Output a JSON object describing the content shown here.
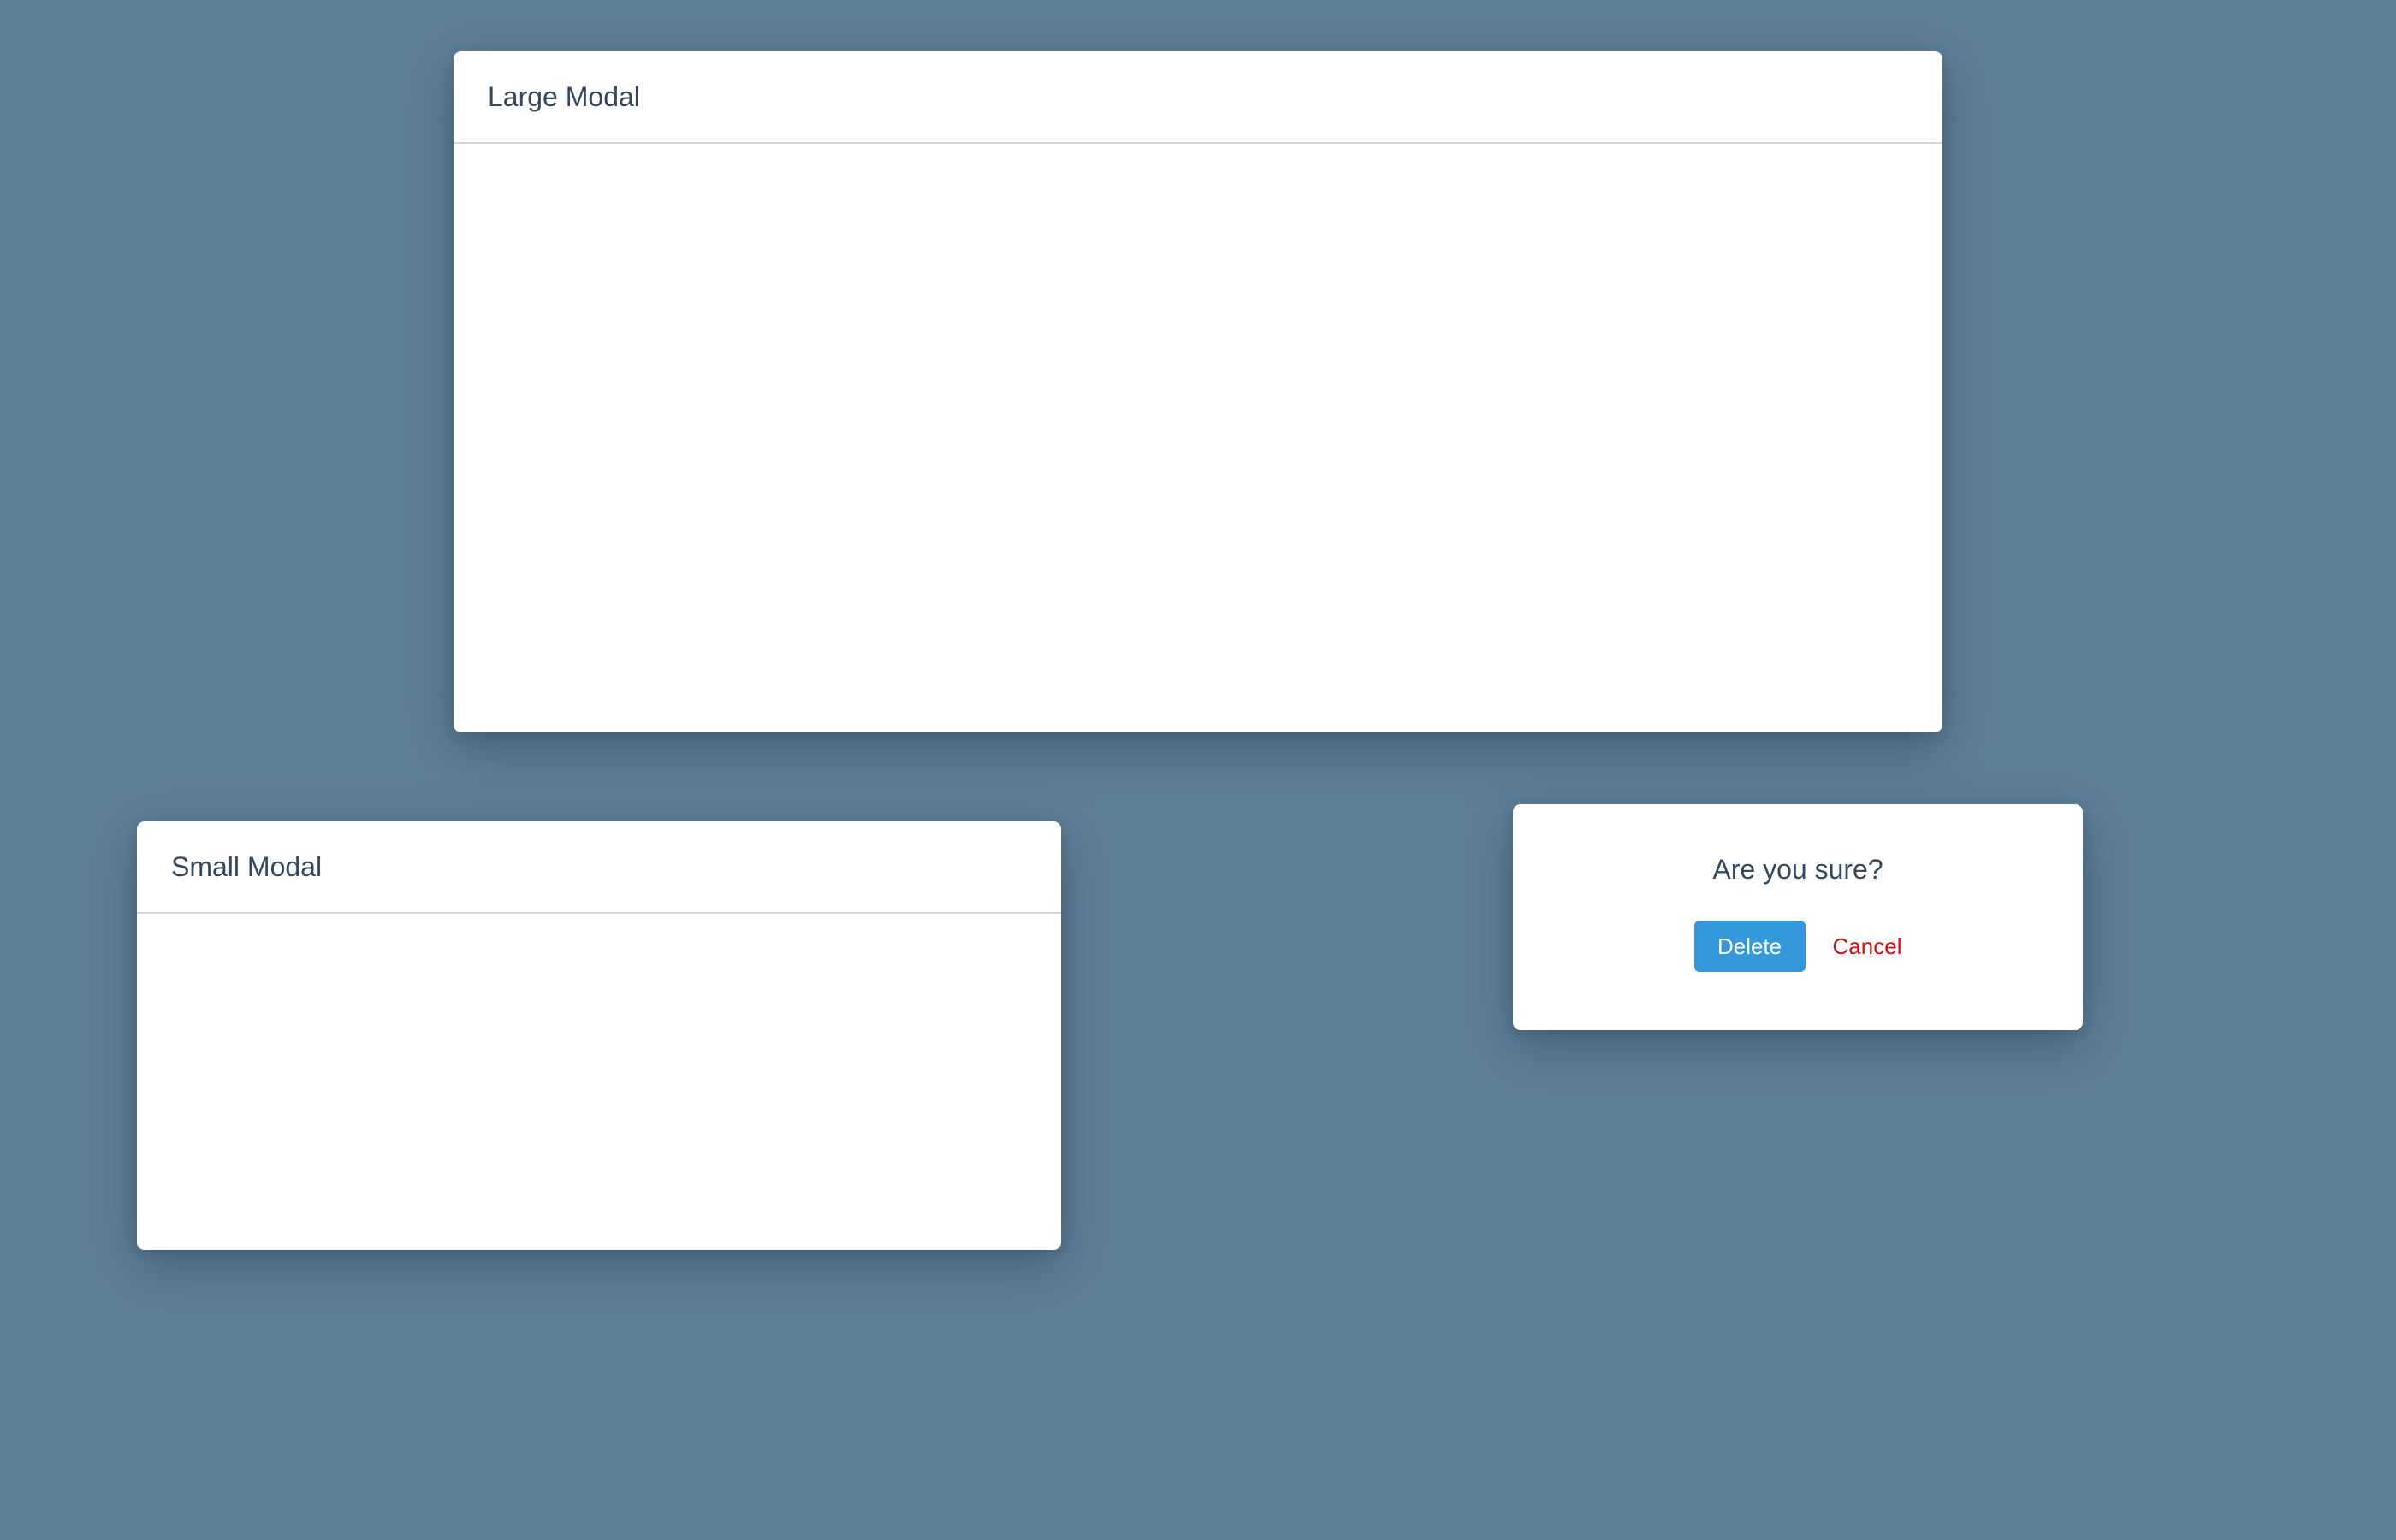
{
  "large_modal": {
    "title": "Large Modal"
  },
  "small_modal": {
    "title": "Small Modal"
  },
  "confirm_dialog": {
    "question": "Are you sure?",
    "delete_label": "Delete",
    "cancel_label": "Cancel"
  },
  "colors": {
    "background": "#5f8099",
    "modal_background": "#ffffff",
    "primary_button": "#3498db",
    "cancel_text": "#cc1111",
    "heading_text": "#34495e"
  }
}
